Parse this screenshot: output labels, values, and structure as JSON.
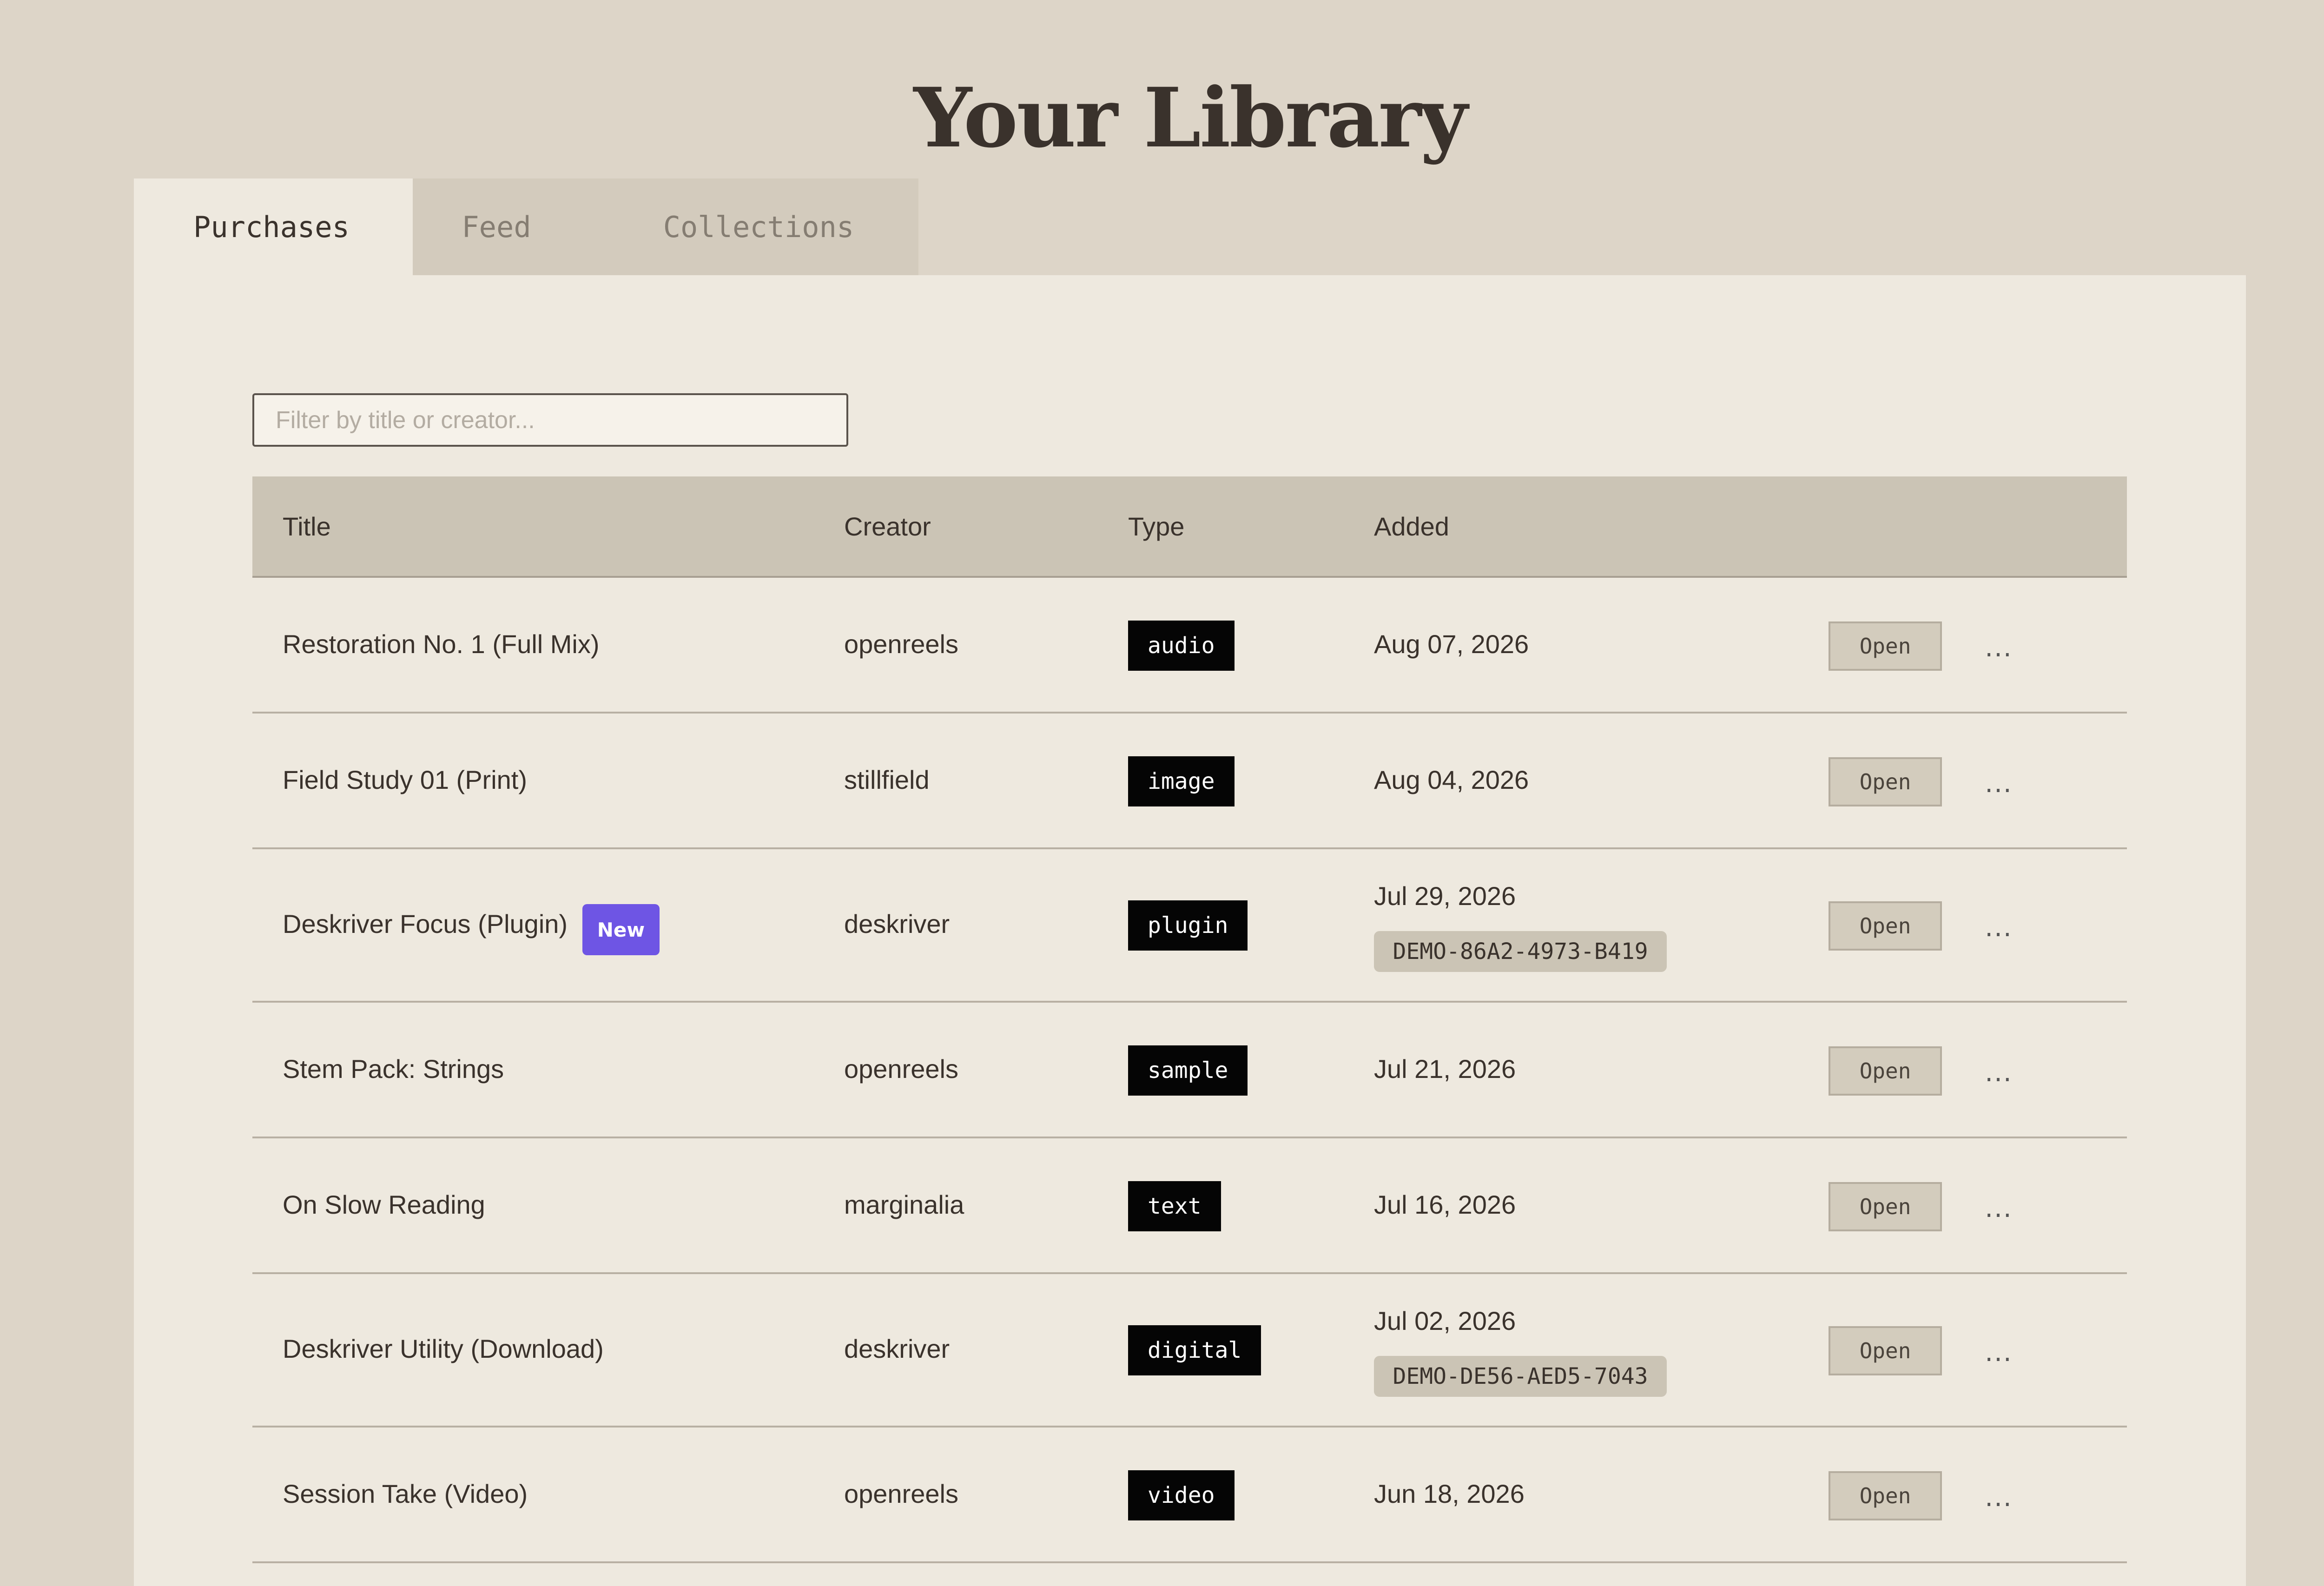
{
  "header": {
    "title": "Your Library"
  },
  "tabs": [
    {
      "label": "Purchases",
      "active": true
    },
    {
      "label": "Feed",
      "active": false
    },
    {
      "label": "Collections",
      "active": false
    }
  ],
  "filter": {
    "placeholder": "Filter by title or creator...",
    "value": ""
  },
  "table": {
    "columns": {
      "title": "Title",
      "creator": "Creator",
      "type": "Type",
      "added": "Added"
    },
    "rows": [
      {
        "title": "Restoration No. 1 (Full Mix)",
        "creator": "openreels",
        "type": "audio",
        "added": "Aug 07, 2026",
        "open": "Open",
        "more": "..."
      },
      {
        "title": "Field Study 01 (Print)",
        "creator": "stillfield",
        "type": "image",
        "added": "Aug 04, 2026",
        "open": "Open",
        "more": "..."
      },
      {
        "title": "Deskriver Focus (Plugin)",
        "badge": "New",
        "creator": "deskriver",
        "type": "plugin",
        "added": "Jul 29, 2026",
        "license": "DEMO-86A2-4973-B419",
        "open": "Open",
        "more": "..."
      },
      {
        "title": "Stem Pack: Strings",
        "creator": "openreels",
        "type": "sample",
        "added": "Jul 21, 2026",
        "open": "Open",
        "more": "..."
      },
      {
        "title": "On Slow Reading",
        "creator": "marginalia",
        "type": "text",
        "added": "Jul 16, 2026",
        "open": "Open",
        "more": "..."
      },
      {
        "title": "Deskriver Utility (Download)",
        "creator": "deskriver",
        "type": "digital",
        "added": "Jul 02, 2026",
        "license": "DEMO-DE56-AED5-7043",
        "open": "Open",
        "more": "..."
      },
      {
        "title": "Session Take (Video)",
        "creator": "openreels",
        "type": "video",
        "added": "Jun 18, 2026",
        "open": "Open",
        "more": "..."
      }
    ]
  },
  "colors": {
    "background": "#ddd5c8",
    "panel": "#eee9df",
    "header_row": "#cbc4b5",
    "new_badge": "#6e55e4",
    "type_badge": "#050505"
  }
}
